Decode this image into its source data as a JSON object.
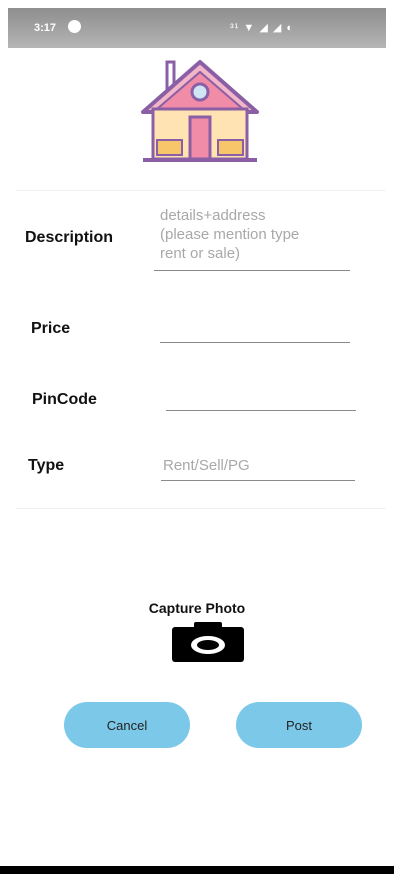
{
  "status_bar": {
    "time": "3:17",
    "right_icons": "³¹ ▼ ◢ ◢ ◐"
  },
  "logo": {
    "icon": "house-icon"
  },
  "form": {
    "description": {
      "label": "Description",
      "placeholder": "details+address\n(please mention type\nrent or sale)"
    },
    "price": {
      "label": "Price",
      "value": ""
    },
    "pincode": {
      "label": "PinCode",
      "value": ""
    },
    "type": {
      "label": "Type",
      "placeholder": "Rent/Sell/PG"
    }
  },
  "capture": {
    "title": "Capture Photo",
    "icon": "camera-icon"
  },
  "buttons": {
    "cancel": "Cancel",
    "post": "Post"
  },
  "colors": {
    "button": "#7cc8e8",
    "house_wall": "#ffe3b3",
    "house_roof": "#f08ba8",
    "house_outline": "#8b5fa5"
  }
}
